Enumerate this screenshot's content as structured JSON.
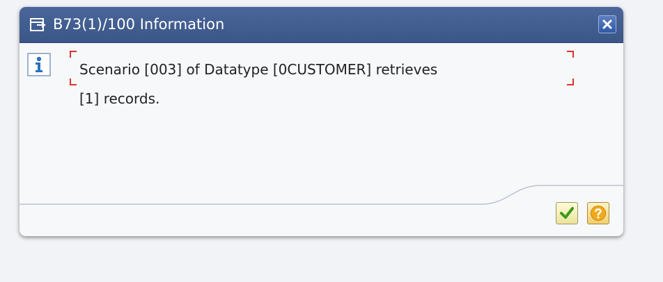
{
  "dialog": {
    "title": "B73(1)/100 Information",
    "message_line1": "Scenario [003] of Datatype [0CUSTOMER] retrieves",
    "message_line2": "[1] records."
  },
  "icons": {
    "title": "dialog-window-icon",
    "close": "close-icon",
    "info": "info-icon",
    "confirm": "checkmark-icon",
    "help": "help-icon"
  },
  "colors": {
    "titlebar": "#3f5b8e",
    "close_button": "#3f67b3",
    "info_icon": "#2d6fc0",
    "message_frame": "#d9342b",
    "confirm_check": "#3b9a1b",
    "help_circle": "#f2a91c"
  }
}
